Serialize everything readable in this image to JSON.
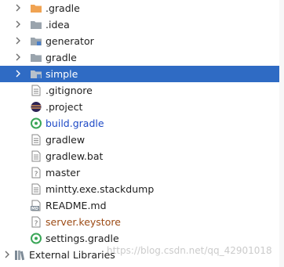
{
  "colors": {
    "selection": "#2f6bc4",
    "folder_orange": "#f0a352",
    "folder_grey": "#9aa4ad",
    "link_blue": "#1d49c6",
    "keystore_brown": "#9c4b15",
    "gradle_green": "#3aa657"
  },
  "tree": {
    "items": [
      {
        "label": ".gradle",
        "icon": "folder-orange-icon",
        "expandable": true
      },
      {
        "label": ".idea",
        "icon": "folder-grey-icon",
        "expandable": true
      },
      {
        "label": "generator",
        "icon": "module-folder-icon",
        "expandable": true
      },
      {
        "label": "gradle",
        "icon": "folder-grey-icon",
        "expandable": true
      },
      {
        "label": "simple",
        "icon": "module-folder-icon",
        "expandable": true,
        "selected": true
      },
      {
        "label": ".gitignore",
        "icon": "text-file-icon",
        "expandable": false
      },
      {
        "label": ".project",
        "icon": "eclipse-project-icon",
        "expandable": false
      },
      {
        "label": "build.gradle",
        "icon": "gradle-file-icon",
        "expandable": false
      },
      {
        "label": "gradlew",
        "icon": "text-file-icon",
        "expandable": false
      },
      {
        "label": "gradlew.bat",
        "icon": "text-file-icon",
        "expandable": false
      },
      {
        "label": "master",
        "icon": "unknown-file-icon",
        "expandable": false
      },
      {
        "label": "mintty.exe.stackdump",
        "icon": "text-file-icon",
        "expandable": false
      },
      {
        "label": "README.md",
        "icon": "markdown-file-icon",
        "expandable": false
      },
      {
        "label": "server.keystore",
        "icon": "unknown-file-icon",
        "expandable": false
      },
      {
        "label": "settings.gradle",
        "icon": "gradle-file-icon",
        "expandable": false
      }
    ],
    "external_libraries": {
      "label": "External Libraries",
      "icon": "library-icon"
    }
  },
  "watermark": "https://blog.csdn.net/qq_42901018"
}
